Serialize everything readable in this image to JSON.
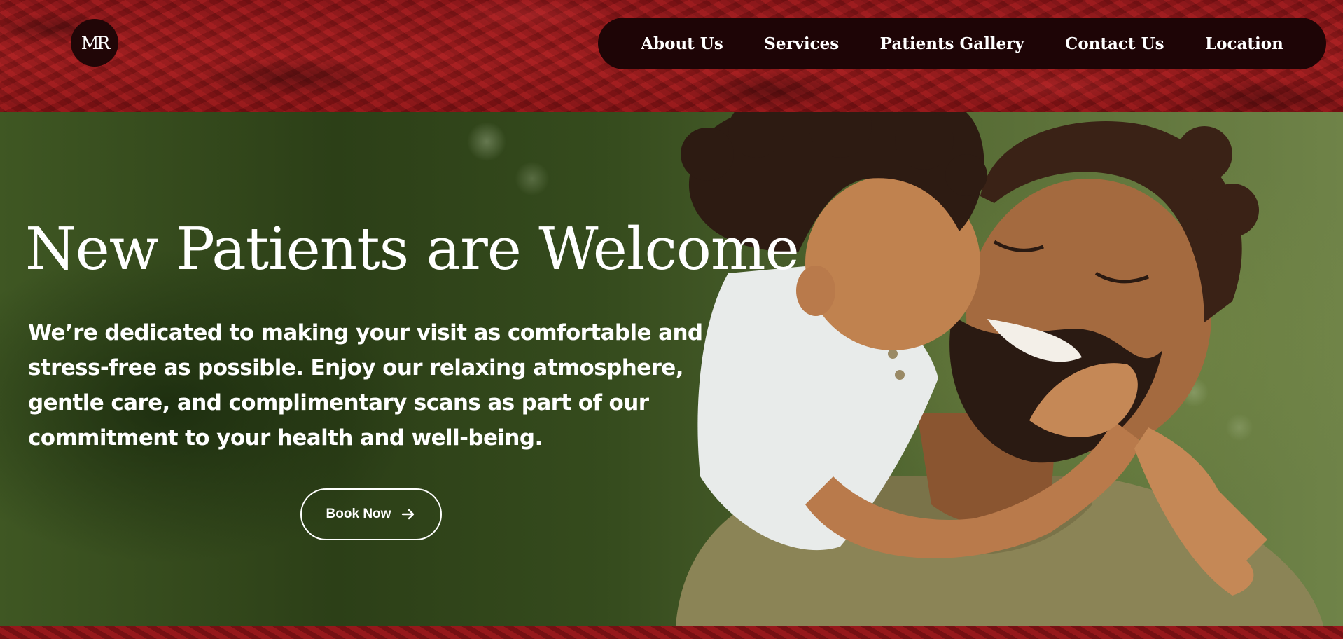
{
  "header": {
    "logo_text": "MR",
    "nav": [
      {
        "label": "About Us"
      },
      {
        "label": "Services"
      },
      {
        "label": "Patients Gallery"
      },
      {
        "label": "Contact Us"
      },
      {
        "label": "Location"
      }
    ]
  },
  "hero": {
    "title": "New Patients are Welcome",
    "description": "We’re dedicated to making your visit as comfortable and stress-free as possible. Enjoy our relaxing atmosphere, gentle care, and complimentary scans as part of our commitment to your health and well-being.",
    "cta_label": "Book Now",
    "cta_icon": "arrow-right-icon"
  },
  "colors": {
    "header_red": "#9e1b1d",
    "nav_bg": "#1e0506",
    "text": "#ffffff"
  }
}
